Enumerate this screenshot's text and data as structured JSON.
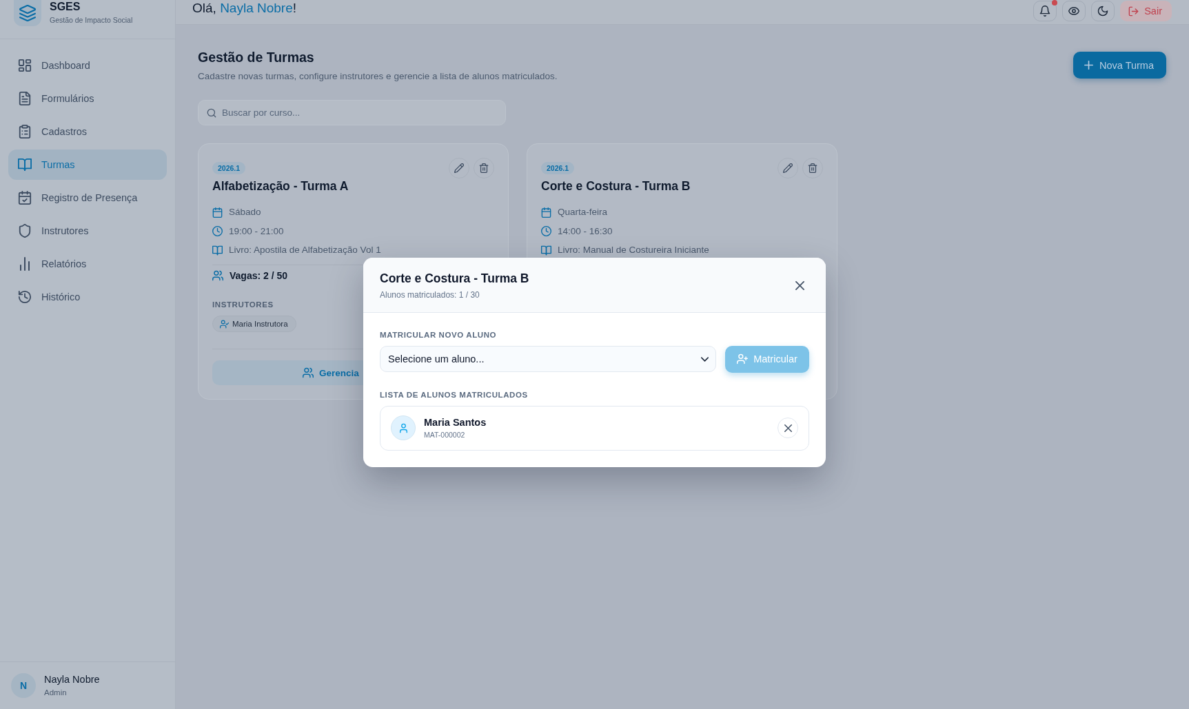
{
  "sidebar": {
    "brand": {
      "name": "SGES",
      "tagline": "Gestão de Impacto Social"
    },
    "items": [
      {
        "label": "Dashboard",
        "selected": false
      },
      {
        "label": "Formulários",
        "selected": false
      },
      {
        "label": "Cadastros",
        "selected": false
      },
      {
        "label": "Turmas",
        "selected": true
      },
      {
        "label": "Registro de Presença",
        "selected": false
      },
      {
        "label": "Instrutores",
        "selected": false
      },
      {
        "label": "Relatórios",
        "selected": false
      },
      {
        "label": "Histórico",
        "selected": false
      }
    ],
    "user": {
      "initial": "N",
      "name": "Nayla Nobre",
      "role": "Admin"
    }
  },
  "header": {
    "greeting": "Olá, ",
    "user_name": "Nayla Nobre",
    "greeting_end": "!",
    "notification": true,
    "logout_button": "Sair"
  },
  "page": {
    "title": "Gestão de Turmas",
    "subtitle": "Cadastre novas turmas, configure instrutores e gerencie a lista de alunos matriculados.",
    "new_button": "Nova Turma",
    "search": {
      "placeholder": "Buscar por curso..."
    }
  },
  "classes": [
    {
      "period": "2026.1",
      "title": "Alfabetização - Turma A",
      "day": "Sábado",
      "time": "19:00 - 21:00",
      "book": "Livro: Apostila de Alfabetização Vol 1",
      "vacancies": "Vagas: 2 / 50",
      "instructors_label": "INSTRUTORES",
      "instructors": [
        {
          "name": "Maria Instrutora"
        }
      ],
      "manage_button": "Gerencia"
    },
    {
      "period": "2026.1",
      "title": "Corte e Costura - Turma B",
      "day": "Quarta-feira",
      "time": "14:00 - 16:30",
      "book": "Livro: Manual de Costureira Iniciante"
    }
  ],
  "modal": {
    "title": "Corte e Costura - Turma B",
    "subtitle": "Alunos matriculados: 1 / 30",
    "enroll_label": "MATRICULAR NOVO ALUNO",
    "student_select": {
      "value": "Selecione um aluno..."
    },
    "enroll_button": {
      "label": "Matricular",
      "disabled": true
    },
    "list_label": "LISTA DE ALUNOS MATRICULADOS",
    "students": [
      {
        "name": "Maria Santos",
        "id": "MAT-000002"
      }
    ]
  }
}
